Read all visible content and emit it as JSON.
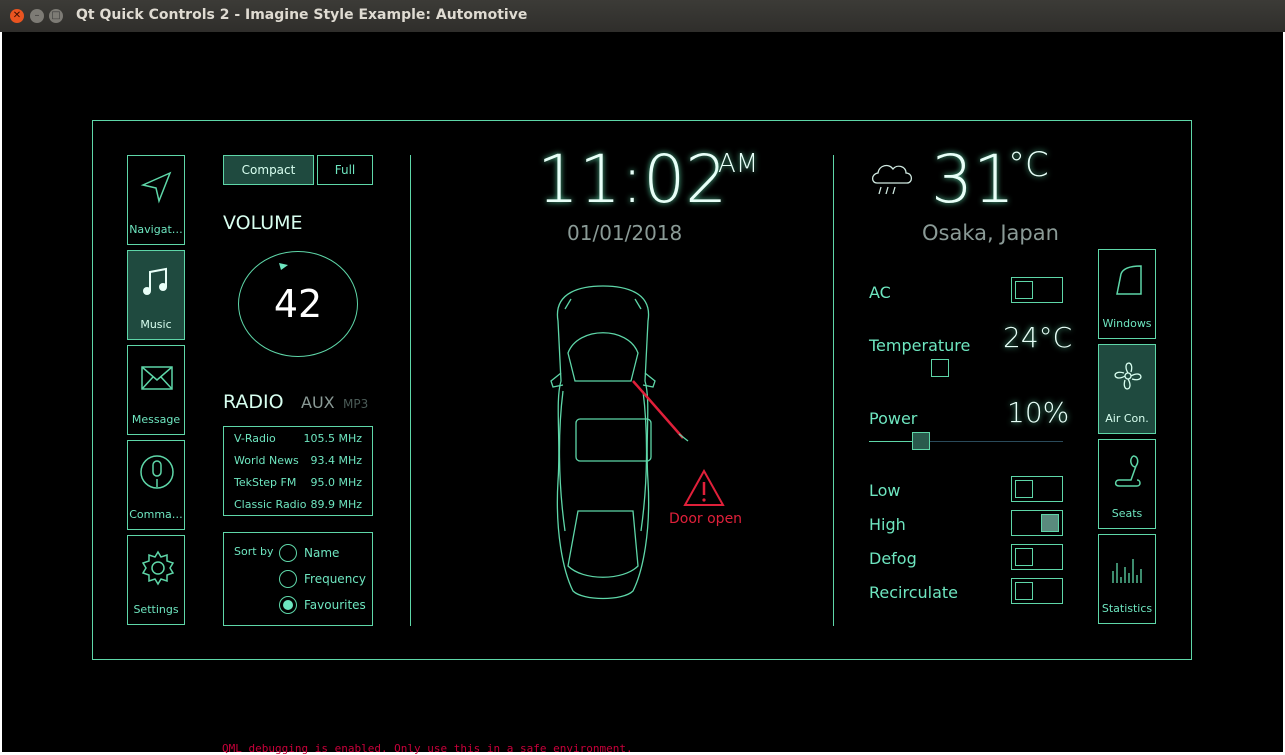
{
  "window": {
    "title": "Qt Quick Controls 2 - Imagine Style Example: Automotive"
  },
  "left_nav": [
    {
      "label": "Navigat…",
      "icon": "navigation-arrow-icon",
      "active": false
    },
    {
      "label": "Music",
      "icon": "music-note-icon",
      "active": true
    },
    {
      "label": "Message",
      "icon": "envelope-icon",
      "active": false
    },
    {
      "label": "Comma…",
      "icon": "microphone-icon",
      "active": false
    },
    {
      "label": "Settings",
      "icon": "gear-icon",
      "active": false
    }
  ],
  "view_mode": {
    "compact": "Compact",
    "full": "Full",
    "selected": "Compact"
  },
  "volume": {
    "label": "VOLUME",
    "value": "42"
  },
  "radio": {
    "label": "RADIO",
    "aux": "AUX",
    "mp3": "MP3",
    "stations": [
      {
        "name": "V-Radio",
        "freq": "105.5 MHz"
      },
      {
        "name": "World News",
        "freq": "93.4 MHz"
      },
      {
        "name": "TekStep FM",
        "freq": "95.0 MHz"
      },
      {
        "name": "Classic Radio",
        "freq": "89.9 MHz"
      }
    ]
  },
  "sort": {
    "label": "Sort by",
    "options": [
      "Name",
      "Frequency",
      "Favourites"
    ],
    "selected": "Favourites"
  },
  "clock": {
    "time": "11:02",
    "ampm": "AM",
    "date": "01/01/2018"
  },
  "car": {
    "warning": "Door open"
  },
  "weather": {
    "temp": "31",
    "unit": "°C",
    "location": "Osaka, Japan",
    "icon": "rain-cloud-icon"
  },
  "climate": {
    "ac_label": "AC",
    "ac_on": false,
    "temperature_label": "Temperature",
    "temperature_value": "24°C",
    "power_label": "Power",
    "power_value": "10%",
    "power_level": 0.1,
    "low_label": "Low",
    "low_on": false,
    "high_label": "High",
    "high_on": true,
    "defog_label": "Defog",
    "defog_on": false,
    "recirculate_label": "Recirculate",
    "recirculate_on": false
  },
  "right_nav": [
    {
      "label": "Windows",
      "icon": "window-icon",
      "active": false
    },
    {
      "label": "Air Con.",
      "icon": "fan-icon",
      "active": true
    },
    {
      "label": "Seats",
      "icon": "seat-icon",
      "active": false
    },
    {
      "label": "Statistics",
      "icon": "bar-chart-icon",
      "active": false
    }
  ],
  "console": {
    "text": "QML debugging is enabled. Only use this in a safe environment."
  },
  "colors": {
    "accent": "#5ed6a8",
    "background": "#000000",
    "warning": "#e0203a"
  }
}
